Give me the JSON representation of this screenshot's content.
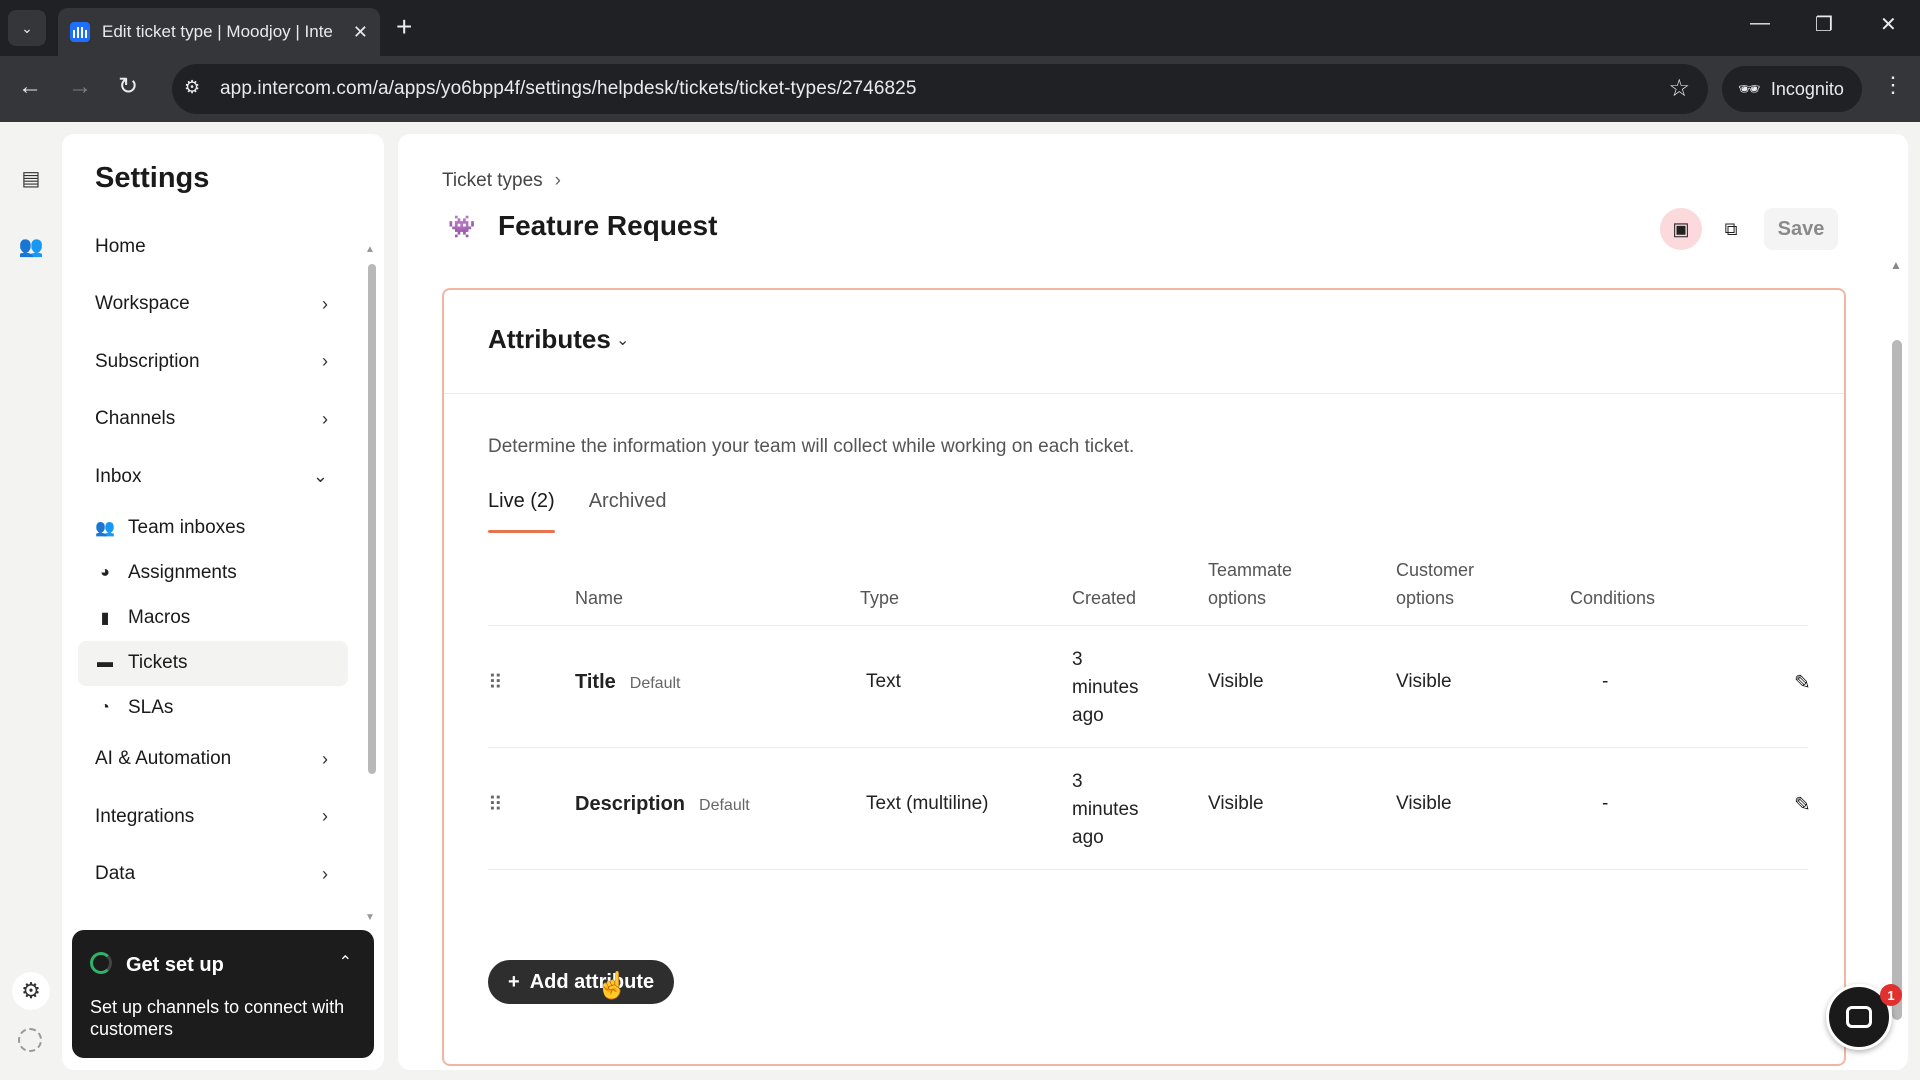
{
  "browser": {
    "tab_title": "Edit ticket type | Moodjoy | Inte",
    "url": "app.intercom.com/a/apps/yo6bpp4f/settings/helpdesk/tickets/ticket-types/2746825",
    "incognito_label": "Incognito"
  },
  "settings": {
    "title": "Settings",
    "nav": [
      {
        "label": "Home"
      },
      {
        "label": "Workspace"
      },
      {
        "label": "Subscription"
      },
      {
        "label": "Channels"
      },
      {
        "label": "Inbox"
      }
    ],
    "inbox_items": [
      {
        "label": "Team inboxes",
        "icon": "team-icon"
      },
      {
        "label": "Assignments",
        "icon": "assignment-icon"
      },
      {
        "label": "Macros",
        "icon": "bookmark-icon"
      },
      {
        "label": "Tickets",
        "icon": "ticket-icon"
      },
      {
        "label": "SLAs",
        "icon": "clock-icon"
      }
    ],
    "nav_after": [
      {
        "label": "AI & Automation"
      },
      {
        "label": "Integrations"
      },
      {
        "label": "Data"
      }
    ]
  },
  "get_set_up": {
    "title": "Get set up",
    "body": "Set up channels to connect with customers"
  },
  "main": {
    "breadcrumb": "Ticket types",
    "title": "Feature Request",
    "save_label": "Save",
    "attributes": {
      "title": "Attributes",
      "description": "Determine the information your team will collect while working on each ticket.",
      "tabs": [
        "Live (2)",
        "Archived"
      ],
      "columns": {
        "name": "Name",
        "type": "Type",
        "created": "Created",
        "teammate_1": "Teammate",
        "teammate_2": "options",
        "customer_1": "Customer",
        "customer_2": "options",
        "conditions": "Conditions"
      },
      "rows": [
        {
          "name": "Title",
          "badge": "Default",
          "type": "Text",
          "created_1": "3",
          "created_2": "minutes",
          "created_3": "ago",
          "teammate": "Visible",
          "customer": "Visible",
          "conditions": "-"
        },
        {
          "name": "Description",
          "badge": "Default",
          "type": "Text (multiline)",
          "created_1": "3",
          "created_2": "minutes",
          "created_3": "ago",
          "teammate": "Visible",
          "customer": "Visible",
          "conditions": "-"
        }
      ],
      "add_button": "Add attribute"
    }
  },
  "messenger_badge": "1",
  "colors": {
    "accent": "#e8744f",
    "card_border": "#f0b6a3",
    "archive_btn_bg": "#fbd9dc"
  }
}
